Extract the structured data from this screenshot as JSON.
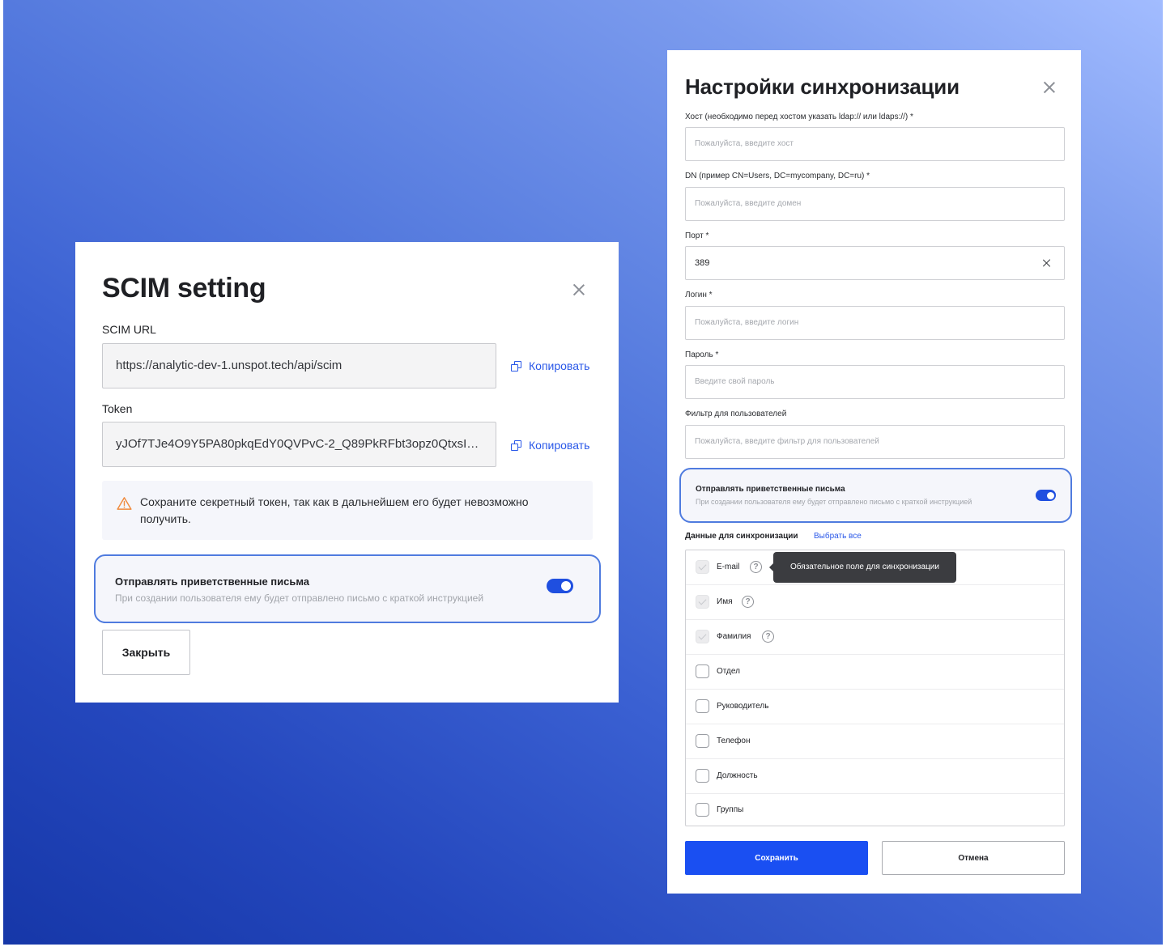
{
  "scim_dialog": {
    "title": "SCIM setting",
    "url_label": "SCIM URL",
    "url_value": "https://analytic-dev-1.unspot.tech/api/scim",
    "token_label": "Token",
    "token_value": "yJOf7TJe4O9Y5PA80pkqEdY0QVPvC-2_Q89PkRFbt3opz0QtxsImf...",
    "copy_label": "Копировать",
    "warning_text": "Сохраните секретный токен, так как в дальнейшем его будет невозможно получить.",
    "welcome_title": "Отправлять приветственные письма",
    "welcome_subtitle": "При создании пользователя ему будет отправлено письмо с краткой инструкцией",
    "welcome_enabled": true,
    "close_button": "Закрыть"
  },
  "sync_dialog": {
    "title": "Настройки синхронизации",
    "fields": [
      {
        "label": "Хост (необходимо перед хостом указать ldap:// или ldaps://) *",
        "placeholder": "Пожалуйста, введите хост",
        "value": ""
      },
      {
        "label": "DN (пример CN=Users, DC=mycompany, DC=ru) *",
        "placeholder": "Пожалуйста, введите домен",
        "value": ""
      },
      {
        "label": "Порт *",
        "placeholder": "",
        "value": "389"
      },
      {
        "label": "Логин *",
        "placeholder": "Пожалуйста, введите логин",
        "value": ""
      },
      {
        "label": "Пароль *",
        "placeholder": "Введите свой пароль",
        "value": ""
      },
      {
        "label": "Фильтр для пользователей",
        "placeholder": "Пожалуйста, введите фильтр для пользователей",
        "value": ""
      }
    ],
    "welcome_title": "Отправлять приветственные письма",
    "welcome_subtitle": "При создании пользователя ему будет отправлено письмо с краткой инструкцией",
    "welcome_enabled": true,
    "sync_data_label": "Данные для синхронизации",
    "select_all": "Выбрать все",
    "checkboxes": [
      {
        "label": "E-mail",
        "checked": true,
        "disabled": true,
        "help": "?"
      },
      {
        "label": "Имя",
        "checked": true,
        "disabled": true,
        "help": "?"
      },
      {
        "label": "Фамилия",
        "checked": true,
        "disabled": true,
        "help": "?"
      },
      {
        "label": "Отдел",
        "checked": false,
        "disabled": false
      },
      {
        "label": "Руководитель",
        "checked": false,
        "disabled": false
      },
      {
        "label": "Телефон",
        "checked": false,
        "disabled": false
      },
      {
        "label": "Должность",
        "checked": false,
        "disabled": false
      },
      {
        "label": "Группы",
        "checked": false,
        "disabled": false
      }
    ],
    "tooltip": "Обязательное поле для синхронизации",
    "save_button": "Сохранить",
    "cancel_button": "Отмена"
  },
  "colors": {
    "accent": "#1a4ff2",
    "link": "#2a58e8",
    "highlight_border": "#4f7bdf",
    "warning": "#f08a3c"
  }
}
